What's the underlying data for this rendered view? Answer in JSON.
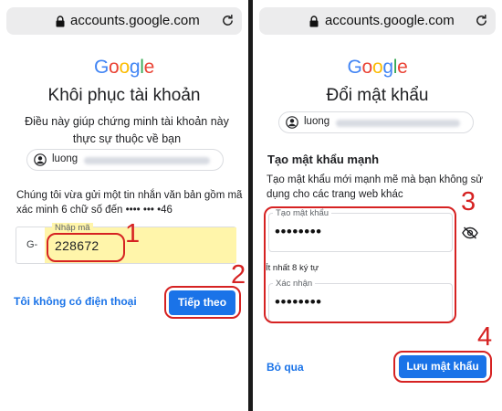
{
  "browser": {
    "left_url": "accounts.google.com",
    "right_url": "accounts.google.com"
  },
  "brand": {
    "letters": [
      "G",
      "o",
      "o",
      "g",
      "l",
      "e"
    ],
    "colors": [
      "#4285F4",
      "#EA4335",
      "#FBBC05",
      "#4285F4",
      "#34A853",
      "#EA4335"
    ]
  },
  "left": {
    "title": "Khôi phục tài khoản",
    "subtitle": "Điều này giúp chứng minh tài khoản này thực sự thuộc về bạn",
    "account_prefix": "luong",
    "info_line1": "Chúng tôi vừa gửi một tin nhắn văn bản gồm mã",
    "info_line2": "xác minh 6 chữ số đến •••• ••• •46",
    "code_prefix": "G-",
    "code_label": "Nhập mã",
    "code_value": "228672",
    "no_phone_link": "Tôi không có điện thoại",
    "next_button": "Tiếp theo",
    "step1": "1",
    "step2": "2"
  },
  "right": {
    "title": "Đổi mật khẩu",
    "account_prefix": "luong",
    "section_title": "Tạo mật khẩu mạnh",
    "info_line1": "Tạo mật khẩu mới mạnh mẽ mà bạn không sử",
    "info_line2": "dụng cho các trang web khác",
    "password_label": "Tạo mật khẩu",
    "password_value": "••••••••",
    "helper_text": "Ít nhất 8 ký tự",
    "confirm_label": "Xác nhận",
    "confirm_value": "••••••••",
    "skip_link": "Bỏ qua",
    "save_button": "Lưu mật khẩu",
    "step3": "3",
    "step4": "4"
  },
  "icons": {
    "lock": "lock-icon",
    "reload": "reload-icon",
    "avatar": "account-circle-icon",
    "visibility": "eye-off-icon"
  },
  "colors": {
    "accent_blue": "#1a73e8",
    "annotation_red": "#d62222",
    "autofill_yellow": "#fff5aa"
  }
}
